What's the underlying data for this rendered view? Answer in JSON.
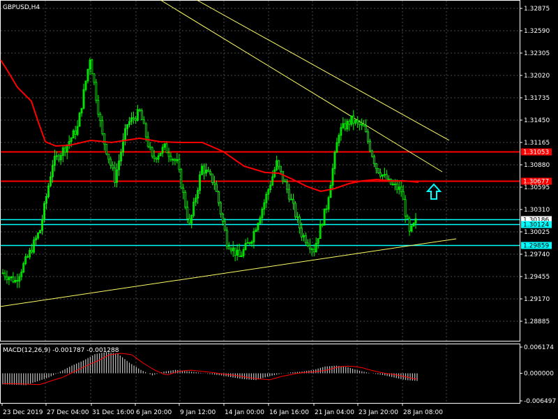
{
  "colors": {
    "background": "#000000",
    "frame": "#ffffff",
    "grid": "#4a4a4a",
    "candle": "#00ff00",
    "ma_line": "#ff0000",
    "trendline": "#ffff66",
    "resistance": "#ff0000",
    "support": "#00ffff",
    "macd_hist": "#c0c0c0",
    "macd_signal": "#ff0000",
    "arrow": "#00ffff"
  },
  "chart_data": [
    {
      "type": "candlestick",
      "title": "GBPUSD,H4",
      "ylim": [
        1.286,
        1.3293
      ],
      "yticks": [
        "1.32875",
        "1.32590",
        "1.32305",
        "1.32020",
        "1.31735",
        "1.31450",
        "1.31165",
        "1.30880",
        "1.30595",
        "1.30310",
        "1.30025",
        "1.29740",
        "1.29455",
        "1.29170",
        "1.28885"
      ],
      "xticks": [
        "23 Dec 2019",
        "27 Dec 04:00",
        "31 Dec 16:00",
        "6 Jan 20:00",
        "9 Jan 12:00",
        "14 Jan 00:00",
        "16 Jan 16:00",
        "21 Jan 04:00",
        "23 Jan 20:00",
        "28 Jan 08:00"
      ],
      "horizontal_levels": [
        {
          "price": 1.31053,
          "label": "1.31053",
          "style": "red"
        },
        {
          "price": 1.30677,
          "label": "1.30677",
          "style": "red"
        },
        {
          "price": 1.30186,
          "label": "1.30186",
          "style": "cyan"
        },
        {
          "price": 1.30124,
          "label": "1.30124",
          "style": "cyan"
        },
        {
          "price": 1.29859,
          "label": "1.29859",
          "style": "cyan"
        }
      ],
      "indicator": "moving average (red)"
    },
    {
      "type": "bar",
      "title": "MACD(12,26,9) -0.001787 -0.001288",
      "ylim": [
        -0.006497,
        0.006174
      ],
      "yticks": [
        "0.006174",
        "0.000000",
        "-0.006497"
      ]
    }
  ]
}
